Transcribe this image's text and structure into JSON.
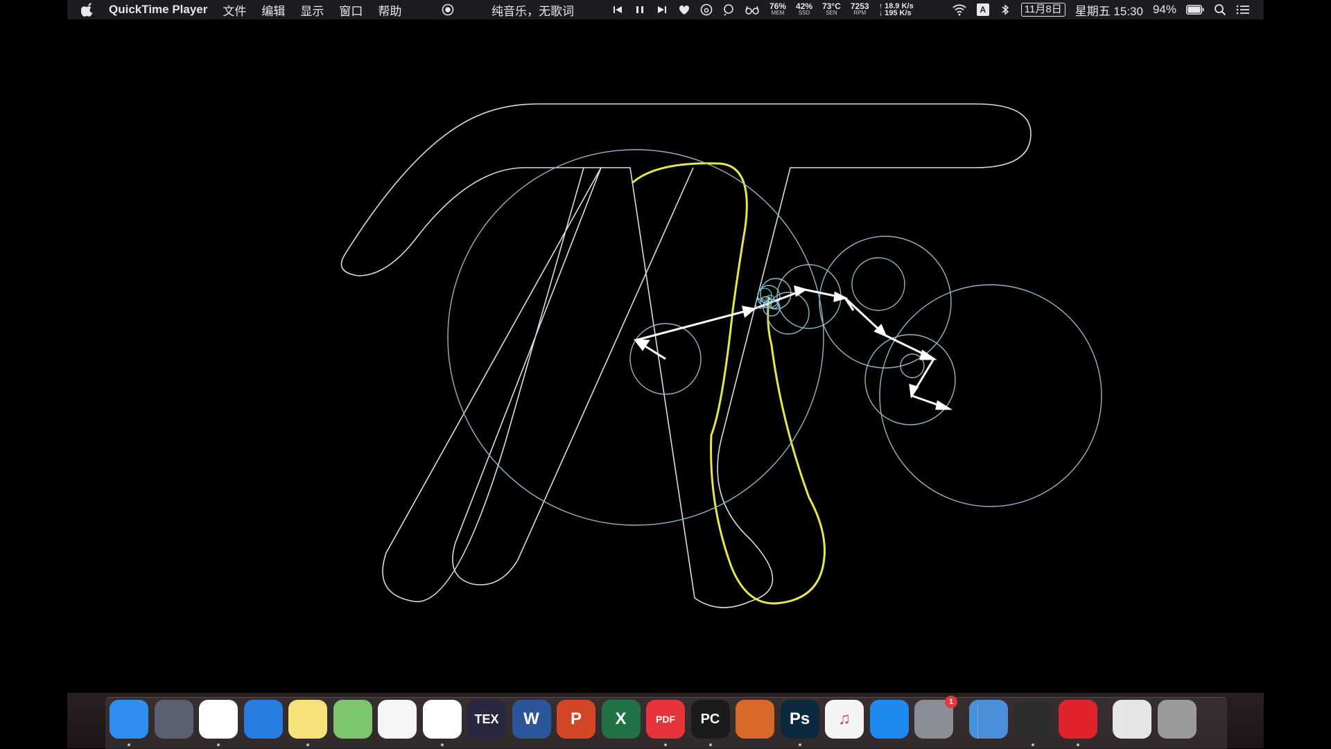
{
  "menubar": {
    "app_name": "QuickTime Player",
    "menus": [
      "文件",
      "编辑",
      "显示",
      "窗口",
      "帮助"
    ],
    "now_playing": "纯音乐，无歌词",
    "stats": [
      {
        "value": "76%",
        "label": "MEM"
      },
      {
        "value": "42%",
        "label": "SSD"
      },
      {
        "value": "73°C",
        "label": "SEN"
      },
      {
        "value": "7253",
        "label": "RPM"
      }
    ],
    "net_up": "18.9 K/s",
    "net_down": "195 K/s",
    "input_method": "A",
    "date": "11月8日",
    "clock": "星期五 15:30",
    "battery": "94%"
  },
  "dock": {
    "apps": [
      {
        "name": "finder",
        "label": "",
        "color": "#2e8ff0"
      },
      {
        "name": "launchpad",
        "label": "",
        "color": "#5a6070"
      },
      {
        "name": "chrome",
        "label": "",
        "color": "#ffffff"
      },
      {
        "name": "safari",
        "label": "",
        "color": "#2a7de0"
      },
      {
        "name": "notes",
        "label": "",
        "color": "#f7e27a"
      },
      {
        "name": "maps",
        "label": "",
        "color": "#7ec66d"
      },
      {
        "name": "reminders",
        "label": "",
        "color": "#f5f5f5"
      },
      {
        "name": "baidu-netdisk",
        "label": "",
        "color": "#ffffff"
      },
      {
        "name": "tex",
        "label": "TEX",
        "color": "#2a2740"
      },
      {
        "name": "word",
        "label": "W",
        "color": "#2b579a"
      },
      {
        "name": "powerpoint",
        "label": "P",
        "color": "#d24726"
      },
      {
        "name": "excel",
        "label": "X",
        "color": "#207245"
      },
      {
        "name": "pdf-expert",
        "label": "PDF",
        "color": "#e8323c"
      },
      {
        "name": "pycharm",
        "label": "PC",
        "color": "#1b1b1b"
      },
      {
        "name": "matlab",
        "label": "",
        "color": "#d9692a"
      },
      {
        "name": "photoshop",
        "label": "Ps",
        "color": "#0c2a3e"
      },
      {
        "name": "itunes",
        "label": "♫",
        "color": "#f4f4f4"
      },
      {
        "name": "app-store",
        "label": "",
        "color": "#1e8af0"
      },
      {
        "name": "system-preferences",
        "label": "",
        "color": "#8a8d95",
        "badge": "1"
      },
      {
        "name": "preview",
        "label": "",
        "color": "#4a90d9"
      },
      {
        "name": "quicktime",
        "label": "",
        "color": "#2d2d2d"
      },
      {
        "name": "netease-music",
        "label": "",
        "color": "#e1232c"
      },
      {
        "name": "documents-folder",
        "label": "",
        "color": "#e6e6e6"
      },
      {
        "name": "trash",
        "label": "",
        "color": "#9a9a9a"
      }
    ]
  },
  "colors": {
    "outline": "#d8dde2",
    "trace": "#e8e64a",
    "circles": "#8fb8c4",
    "vectors": "#ffffff"
  }
}
